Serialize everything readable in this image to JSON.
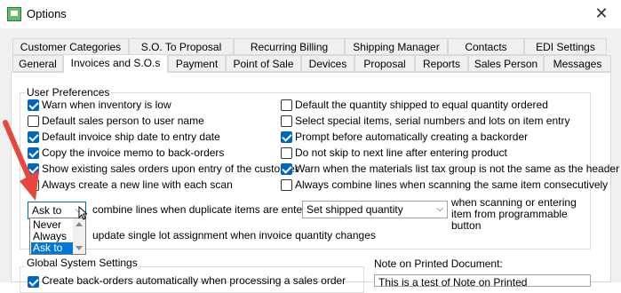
{
  "window": {
    "title": "Options"
  },
  "tabs_row1": [
    "Customer Categories",
    "S.O. To Proposal",
    "Recurring Billing",
    "Shipping Manager",
    "Contacts",
    "EDI Settings"
  ],
  "tabs_row2": [
    "General",
    "Invoices and S.O.s",
    "Payment",
    "Point of Sale",
    "Devices",
    "Proposal",
    "Reports",
    "Sales Person",
    "Messages"
  ],
  "active_tab": "Invoices and S.O.s",
  "user_prefs": {
    "label": "User Preferences",
    "left": [
      {
        "label": "Warn when inventory is low",
        "checked": true
      },
      {
        "label": "Default sales person to user name",
        "checked": false
      },
      {
        "label": "Default invoice ship date to entry date",
        "checked": true
      },
      {
        "label": "Copy the invoice memo to back-orders",
        "checked": true
      },
      {
        "label": "Show existing sales orders upon entry of the customer",
        "checked": true
      },
      {
        "label": "Always create a new line with each scan",
        "checked": false
      }
    ],
    "right": [
      {
        "label": "Default the quantity shipped to equal quantity ordered",
        "checked": false
      },
      {
        "label": "Select special items, serial numbers and lots on item entry",
        "checked": false
      },
      {
        "label": "Prompt before automatically creating a backorder",
        "checked": true
      },
      {
        "label": "Do not skip to next line after entering product",
        "checked": false
      },
      {
        "label": "Warn when the materials list tax group is not the same as the header",
        "checked": true
      },
      {
        "label": "Always combine lines when scanning the same item consecutively",
        "checked": false
      }
    ],
    "combine_select": {
      "value": "Ask to",
      "options": [
        "Never",
        "Always",
        "Ask to"
      ],
      "selected": "Ask to"
    },
    "combine_text": "combine lines when duplicate items are entered.",
    "shipped_select": {
      "value": "Set shipped quantity"
    },
    "scan_text": "when scanning or entering item from programmable button",
    "lot_text": "update single lot assignment when invoice quantity changes"
  },
  "global": {
    "label": "Global System Settings",
    "first_item": "Create back-orders automatically when processing a sales order",
    "first_checked": true
  },
  "note": {
    "label": "Note on Printed Document:",
    "value": "This is a test of Note on Printed"
  },
  "colors": {
    "accent": "#0067c0",
    "selection": "#0078d7",
    "arrow": "#e8473f"
  },
  "icons": [
    "close-icon",
    "chevron-down-icon",
    "mouse-cursor-icon",
    "annotation-arrow-icon"
  ]
}
